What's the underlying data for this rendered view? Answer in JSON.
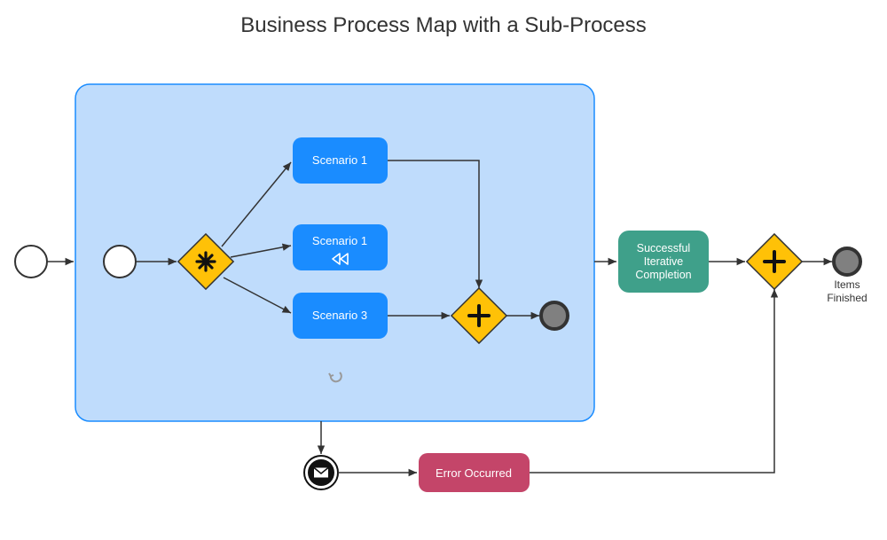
{
  "title": "Business Process Map with a Sub-Process",
  "nodes": {
    "scenario1": "Scenario 1",
    "scenario2": "Scenario 1",
    "scenario3": "Scenario 3",
    "successTask": {
      "line1": "Successful",
      "line2": "Iterative",
      "line3": "Completion"
    },
    "errorTask": "Error Occurred",
    "endLabel": {
      "line1": "Items",
      "line2": "Finished"
    }
  },
  "colors": {
    "subprocessFill": "#bfdcfc",
    "subprocessStroke": "#1a8cff",
    "taskBlue": "#1a8cff",
    "taskGreen": "#3fa08a",
    "taskRed": "#c44569",
    "gatewayFill": "#ffc107",
    "gatewayStroke": "#333",
    "loopMarker": "#999",
    "greyEnd": "#808080"
  }
}
